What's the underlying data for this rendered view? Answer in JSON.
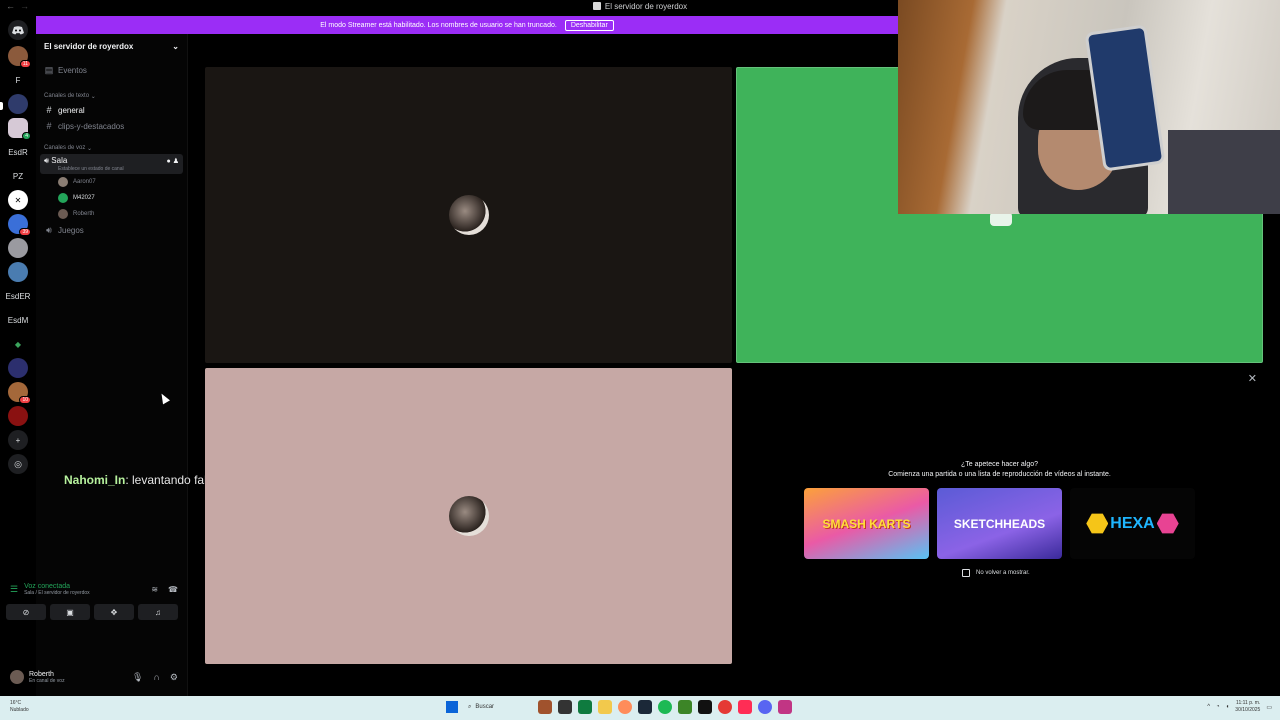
{
  "window": {
    "title": "El servidor de royerdox"
  },
  "banner": {
    "text": "El modo Streamer está habilitado. Los nombres de usuario se han truncado.",
    "button": "Deshabilitar"
  },
  "rail": {
    "items": [
      {
        "name": "discord-home",
        "label": ""
      },
      {
        "name": "server-1",
        "label": "",
        "badge": "11"
      },
      {
        "name": "server-f",
        "label": "F"
      },
      {
        "name": "server-3",
        "label": ""
      },
      {
        "name": "server-4",
        "label": "",
        "badge": "4"
      },
      {
        "name": "server-esdr",
        "label": "EsdR"
      },
      {
        "name": "server-pz",
        "label": "PZ"
      },
      {
        "name": "server-7",
        "label": ""
      },
      {
        "name": "server-8",
        "label": "",
        "badge": "39"
      },
      {
        "name": "server-9",
        "label": ""
      },
      {
        "name": "server-10",
        "label": ""
      },
      {
        "name": "server-esder",
        "label": "EsdER"
      },
      {
        "name": "server-esdm",
        "label": "EsdM"
      },
      {
        "name": "server-13",
        "label": ""
      },
      {
        "name": "server-14",
        "label": ""
      },
      {
        "name": "server-15",
        "label": "",
        "badge": "10"
      },
      {
        "name": "server-16",
        "label": ""
      },
      {
        "name": "add-server",
        "label": "+"
      },
      {
        "name": "discover",
        "label": ""
      }
    ]
  },
  "sidebar": {
    "server_name": "El servidor de royerdox",
    "events": "Eventos",
    "text_category": "Canales de texto",
    "text_channels": [
      "general",
      "clips-y-destacados"
    ],
    "voice_category": "Canales de voz",
    "voice_channel": "Sala",
    "voice_status": "Establece un estado de canal",
    "voice_users": [
      "Aaron07",
      "M42027",
      "Roberth"
    ],
    "other_voice": "Juegos"
  },
  "overlay": {
    "nick": "Nahomi_In",
    "message": ": levantando falsos"
  },
  "voice_panel": {
    "title": "Voz conectada",
    "subtitle": "Sala / El servidor de royerdox"
  },
  "user_panel": {
    "name": "Roberth",
    "status": "En canal de voz"
  },
  "activity": {
    "question": "¿Te apetece hacer algo?",
    "description": "Comienza una partida o una lista de reproducción de vídeos al instante.",
    "games": [
      "SMASH KARTS",
      "SKETCHHEADS",
      "HEXA"
    ],
    "dont_show": "No volver a mostrar."
  },
  "taskbar": {
    "weather_temp": "16°C",
    "weather_desc": "Nublado",
    "search": "Buscar",
    "time": "11:11 p. m.",
    "date": "30/10/2025"
  }
}
